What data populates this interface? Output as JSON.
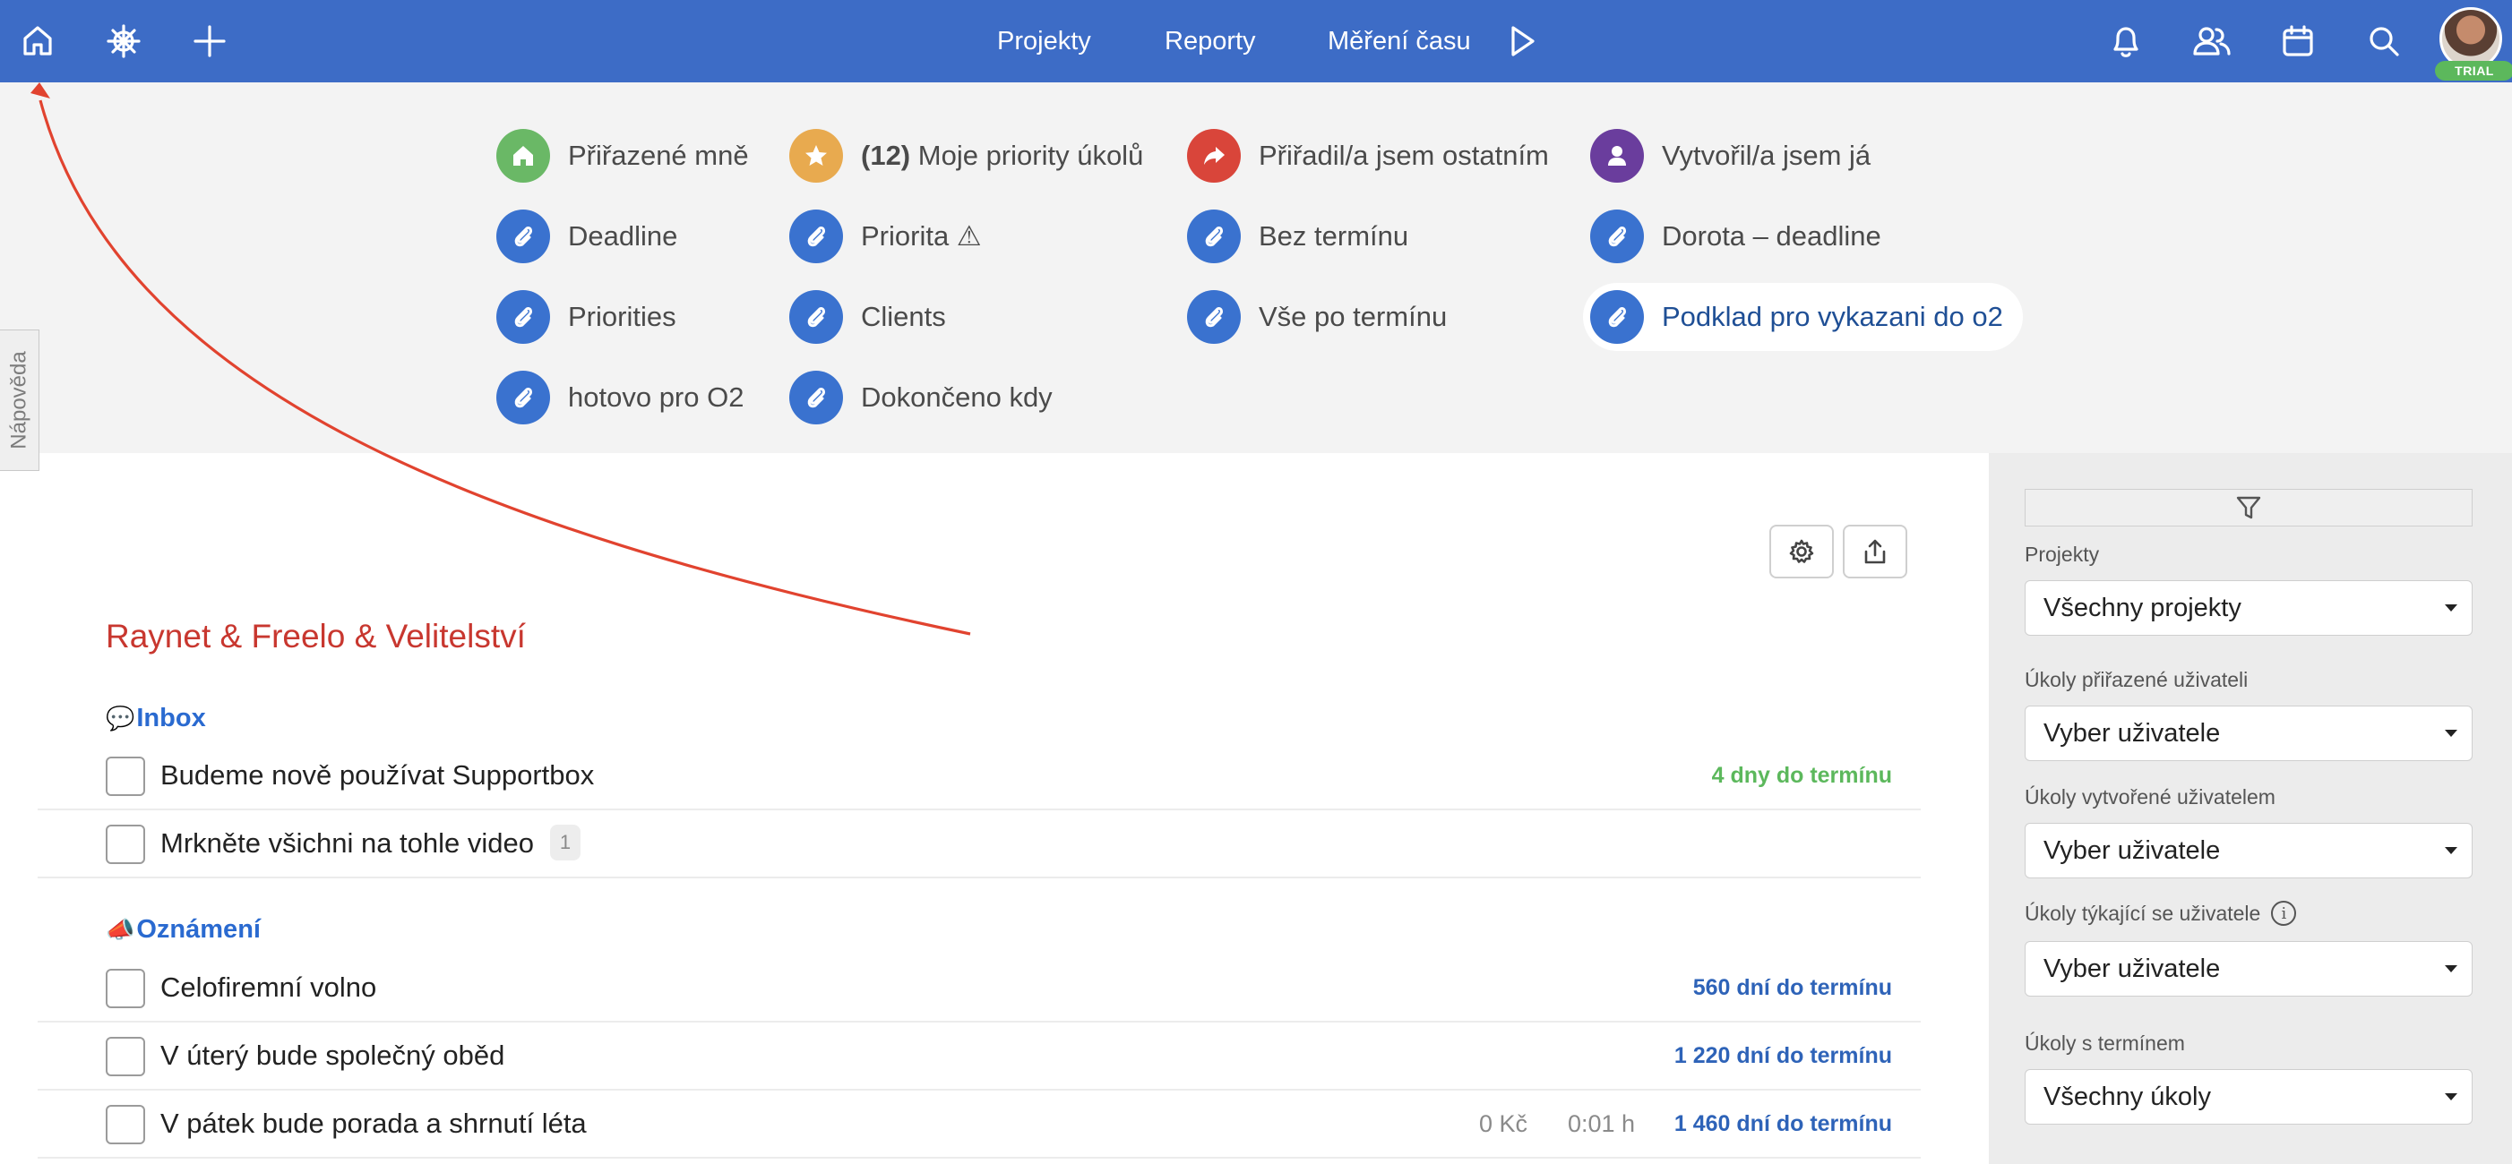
{
  "colors": {
    "topbar": "#3d6cc6",
    "project_title": "#c8372f",
    "section_title": "#2a6ad0",
    "due_green": "#5cb85c",
    "due_blue": "#2e63b8",
    "annotation_arrow": "#e1432f"
  },
  "topbar": {
    "left_icons": [
      "home-icon",
      "helm-icon",
      "plus-icon"
    ],
    "nav": {
      "projects": "Projekty",
      "reports": "Reporty",
      "time_tracking": "Měření času"
    },
    "right_icons": [
      "bell-icon",
      "users-icon",
      "calendar-icon",
      "search-icon"
    ],
    "avatar_badge": "TRIAL"
  },
  "quick_filters": {
    "col1": [
      {
        "label": "Přiřazené mně",
        "icon": "home-icon",
        "color": "#6ab866"
      },
      {
        "label": "Deadline",
        "icon": "paperclip-icon",
        "color": "#3a72cf"
      },
      {
        "label": "Priorities",
        "icon": "paperclip-icon",
        "color": "#3a72cf"
      },
      {
        "label": "hotovo pro O2",
        "icon": "paperclip-icon",
        "color": "#3a72cf"
      }
    ],
    "col2": [
      {
        "count": "(12)",
        "label": "Moje priority úkolů",
        "icon": "star-icon",
        "color": "#e8aa4f"
      },
      {
        "label": "Priorita ⚠",
        "icon": "paperclip-icon",
        "color": "#3a72cf"
      },
      {
        "label": "Clients",
        "icon": "paperclip-icon",
        "color": "#3a72cf"
      },
      {
        "label": "Dokončeno kdy",
        "icon": "paperclip-icon",
        "color": "#3a72cf"
      }
    ],
    "col3": [
      {
        "label": "Přiřadil/a jsem ostatním",
        "icon": "share-arrow-icon",
        "color": "#d9453a"
      },
      {
        "label": "Bez termínu",
        "icon": "paperclip-icon",
        "color": "#3a72cf"
      },
      {
        "label": "Vše po termínu",
        "icon": "paperclip-icon",
        "color": "#3a72cf"
      }
    ],
    "col4": [
      {
        "label": "Vytvořil/a jsem já",
        "icon": "user-icon",
        "color": "#6a3d9d"
      },
      {
        "label": "Dorota – deadline",
        "icon": "paperclip-icon",
        "color": "#3a72cf"
      },
      {
        "label": "Podklad pro vykazani do o2",
        "icon": "paperclip-icon",
        "color": "#3a72cf",
        "selected": true
      }
    ]
  },
  "help_tab": "Nápověda",
  "toolbar_icons": [
    "settings-icon",
    "export-icon"
  ],
  "project": {
    "title": "Raynet & Freelo & Velitelství",
    "sections": [
      {
        "emoji": "💬",
        "title": "Inbox",
        "tasks": [
          {
            "name": "Budeme nově používat Supportbox",
            "due": "4 dny do termínu",
            "due_color": "#5cb85c"
          },
          {
            "name": "Mrkněte všichni na tohle video",
            "badge": "1"
          }
        ]
      },
      {
        "emoji": "📣",
        "title": "Oznámení",
        "tasks": [
          {
            "name": "Celofiremní volno",
            "due": "560 dní do termínu",
            "due_color": "#2e63b8"
          },
          {
            "name": "V úterý bude společný oběd",
            "due": "1 220 dní do termínu",
            "due_color": "#2e63b8"
          },
          {
            "name": "V pátek bude porada a shrnutí léta",
            "cost": "0 Kč",
            "time": "0:01 h",
            "due": "1 460 dní do termínu",
            "due_color": "#2e63b8"
          }
        ]
      }
    ]
  },
  "sidebar": {
    "filter_icon": "funnel-icon",
    "filters": [
      {
        "label": "Projekty",
        "value": "Všechny projekty"
      },
      {
        "label": "Úkoly přiřazené uživateli",
        "value": "Vyber uživatele"
      },
      {
        "label": "Úkoly vytvořené uživatelem",
        "value": "Vyber uživatele"
      },
      {
        "label": "Úkoly týkající se uživatele",
        "value": "Vyber uživatele",
        "info": "i"
      },
      {
        "label": "Úkoly s termínem",
        "value": "Všechny úkoly"
      }
    ]
  }
}
